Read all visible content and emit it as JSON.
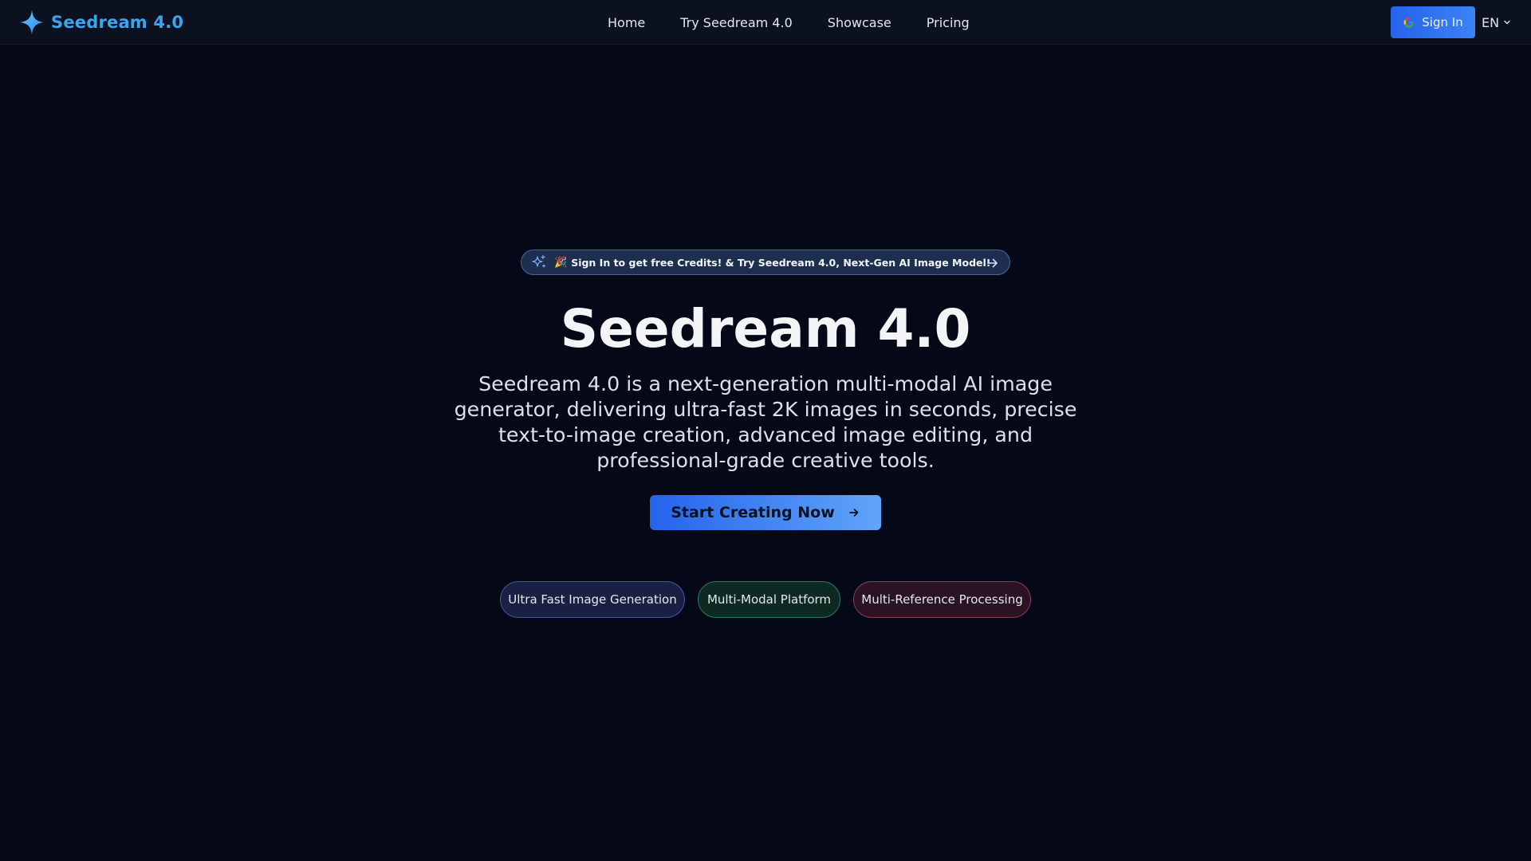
{
  "header": {
    "brand": {
      "name": "Seedream 4.0",
      "icon": "four-point-star-icon",
      "color": "#38a5ee"
    },
    "nav": [
      {
        "label": "Home"
      },
      {
        "label": "Try Seedream 4.0"
      },
      {
        "label": "Showcase"
      },
      {
        "label": "Pricing"
      }
    ],
    "sign_in": {
      "label": "Sign In",
      "icon": "google-icon"
    },
    "language": {
      "label": "EN",
      "icon": "chevron-down-icon"
    }
  },
  "hero": {
    "announcement": {
      "emoji": "🎉",
      "text": "Sign In to get free Credits! & Try Seedream 4.0, Next-Gen AI Image Model!",
      "icons": [
        "sparkles-icon",
        "arrow-right-icon"
      ]
    },
    "title": "Seedream 4.0",
    "description": "Seedream 4.0 is a next-generation multi-modal AI image generator, delivering ultra-fast 2K images in seconds, precise text-to-image creation, advanced image editing, and professional-grade creative tools.",
    "cta": {
      "label": "Start Creating Now",
      "icon": "arrow-right-icon"
    },
    "features": [
      {
        "label": "Ultra Fast Image Generation"
      },
      {
        "label": "Multi-Modal Platform"
      },
      {
        "label": "Multi-Reference Processing"
      }
    ]
  },
  "colors": {
    "background": "#050816",
    "header_background": "#0c1120",
    "accent": "#3b82f6"
  }
}
